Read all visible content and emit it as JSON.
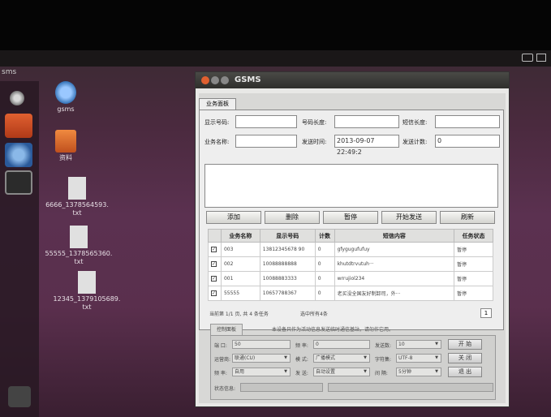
{
  "topbar": {
    "label": "sms"
  },
  "desktop": {
    "icons": [
      {
        "label": "gsms"
      },
      {
        "label": "资料"
      },
      {
        "label": "6666_1378564593.\ntxt"
      },
      {
        "label": "55555_1378565360.\ntxt"
      },
      {
        "label": "12345_1379105689.\ntxt"
      }
    ]
  },
  "window": {
    "title": "GSMS",
    "tab": "业务面板",
    "fields": {
      "phone_label": "显示号码:",
      "phone_len_label": "号码长度:",
      "sms_len_label": "短信长度:",
      "name_label": "业务名称:",
      "send_time_label": "发送时间:",
      "send_time_value": "2013-09-07 22:49:2",
      "send_count_label": "发送计数:",
      "send_count_value": "0"
    },
    "buttons": {
      "add": "添加",
      "delete": "删除",
      "pause": "暂停",
      "start": "开始发送",
      "refresh": "刷新"
    },
    "table": {
      "headers": [
        "",
        "业务名称",
        "显示号码",
        "计数",
        "短信内容",
        "任务状态"
      ],
      "rows": [
        {
          "checked": "✓",
          "name": "003",
          "phone": "13812345678 90",
          "count": "0",
          "content": "gfygugufufuy",
          "status": "暂停"
        },
        {
          "checked": "✓",
          "name": "002",
          "phone": "10088888888",
          "count": "0",
          "content": "khutdtrvutuh···",
          "status": "暂停"
        },
        {
          "checked": "✓",
          "name": "001",
          "phone": "10088883333",
          "count": "0",
          "content": "wrrujiol234",
          "status": "暂停"
        },
        {
          "checked": "✓",
          "name": "55555",
          "phone": "10657788367",
          "count": "0",
          "content": "老买没全国友好制卸司，外···",
          "status": "暂停"
        }
      ]
    },
    "page_info": "当前第 1/1 页, 共 4 条任务",
    "select_all": "选中所有4条",
    "page_num": "1",
    "settings": {
      "tab": "控制面板",
      "notice": "本设备只作为活动信息发送临时通信基站，请勿作它用。",
      "rows": [
        {
          "l1": "端 口:",
          "v1": "50",
          "l2": "频 率:",
          "v2": "0",
          "l3": "发送数:",
          "v3": "10",
          "btn": "开 始"
        },
        {
          "l1": "运营商:",
          "v1": "联通(CU)",
          "l2": "模 式:",
          "v2": "广播模式",
          "l3": "字符集:",
          "v3": "UTF-8",
          "btn": "关 闭"
        },
        {
          "l1": "频 率:",
          "v1": "自用",
          "l2": "发 送:",
          "v2": "自动设置",
          "l3": "间 隔:",
          "v3": "5分钟",
          "btn": "退 出"
        }
      ],
      "status_label": "状态信息:"
    }
  }
}
